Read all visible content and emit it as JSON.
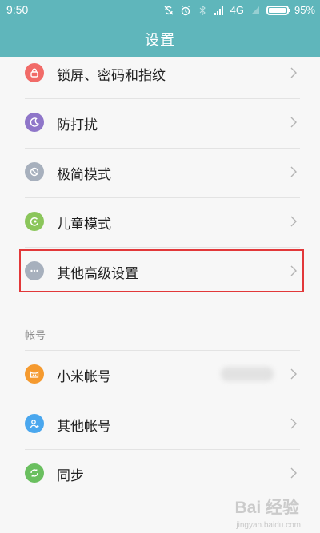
{
  "status_bar": {
    "time": "9:50",
    "network": "4G",
    "battery": "95%",
    "battery_level": 0.95,
    "icons": [
      "sync-off-icon",
      "alarm-icon",
      "bluetooth-icon",
      "signal-icon",
      "wifi-icon",
      "battery-icon"
    ]
  },
  "header": {
    "title": "设置"
  },
  "settings": [
    {
      "label": "锁屏、密码和指纹",
      "icon": "lock-icon",
      "color": "#f16b68"
    },
    {
      "label": "防打扰",
      "icon": "moon-icon",
      "color": "#8f76c9"
    },
    {
      "label": "极简模式",
      "icon": "minimal-mode-icon",
      "color": "#a7b0bd"
    },
    {
      "label": "儿童模式",
      "icon": "child-mode-icon",
      "color": "#8bc65b"
    },
    {
      "label": "其他高级设置",
      "icon": "more-icon",
      "color": "#a7b0bd"
    }
  ],
  "account_section": {
    "label": "帐号",
    "items": [
      {
        "label": "小米帐号",
        "icon": "mi-account-icon",
        "color": "#f59a2f"
      },
      {
        "label": "其他帐号",
        "icon": "user-add-icon",
        "color": "#4aa7ee"
      },
      {
        "label": "同步",
        "icon": "sync-icon",
        "color": "#6abf5f"
      }
    ]
  },
  "watermark": {
    "brand": "Bai",
    "suffix": "经验",
    "url": "jingyan.baidu.com"
  },
  "colors": {
    "header": "#5fb6bb",
    "highlight": "#e2383a"
  }
}
